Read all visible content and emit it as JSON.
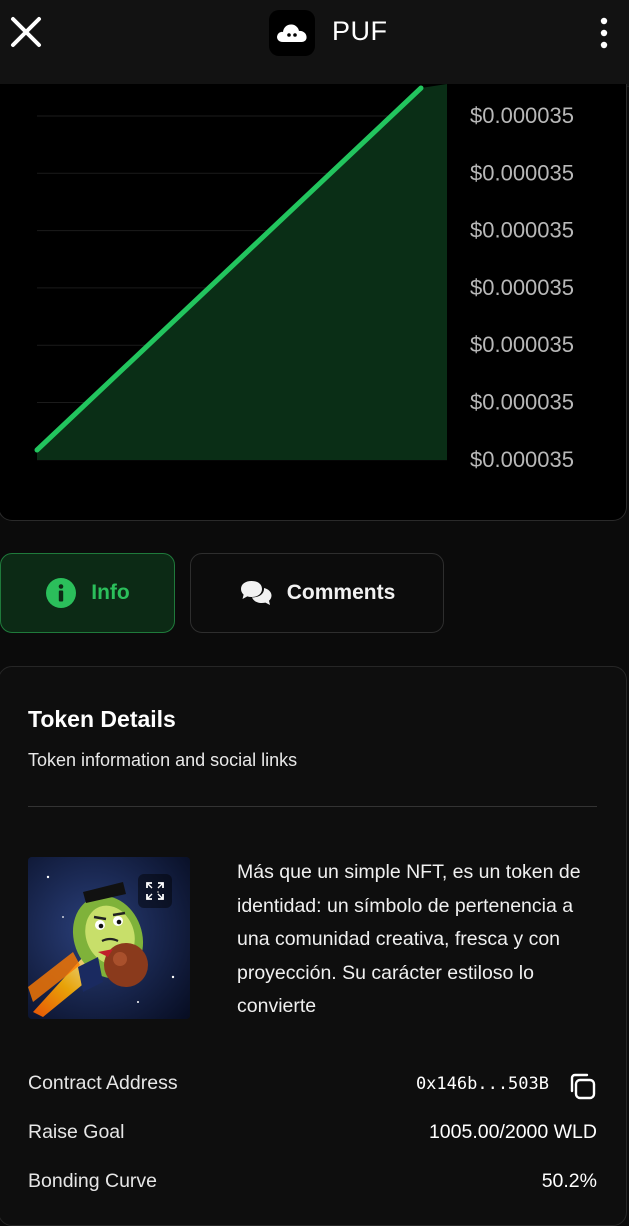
{
  "header": {
    "title": "PUF",
    "close_icon": "close-icon",
    "logo_icon": "cloud-logo-icon",
    "menu_icon": "more-vertical-icon"
  },
  "chart_data": {
    "type": "area",
    "title": "",
    "xlabel": "",
    "ylabel": "",
    "ytick_labels": [
      "$0.000035",
      "$0.000035",
      "$0.000035",
      "$0.000035",
      "$0.000035",
      "$0.000035",
      "$0.000035"
    ],
    "series": [
      {
        "values_fraction": [
          0,
          1
        ]
      }
    ],
    "line_color": "#22c55e",
    "fill_color": "#0a2e16",
    "grid": true
  },
  "tabs": [
    {
      "label": "Info",
      "icon": "info-icon",
      "active": true
    },
    {
      "label": "Comments",
      "icon": "comments-icon",
      "active": false
    }
  ],
  "details": {
    "title": "Token Details",
    "subtitle": "Token information and social links",
    "description": "Más que un simple NFT, es un token de identidad: un símbolo de pertenencia a una comunidad creativa, fresca y con proyección. Su carácter estiloso lo convierte",
    "image_icon": "avocado-token-image",
    "expand_icon": "expand-icon",
    "rows": [
      {
        "label": "Contract Address",
        "value": "0x146b...503B",
        "icon": "copy-icon"
      },
      {
        "label": "Raise Goal",
        "value": "1005.00/2000 WLD"
      },
      {
        "label": "Bonding Curve",
        "value": "50.2%"
      }
    ]
  },
  "colors": {
    "accent": "#22c55e",
    "background": "#0b0b0b"
  }
}
